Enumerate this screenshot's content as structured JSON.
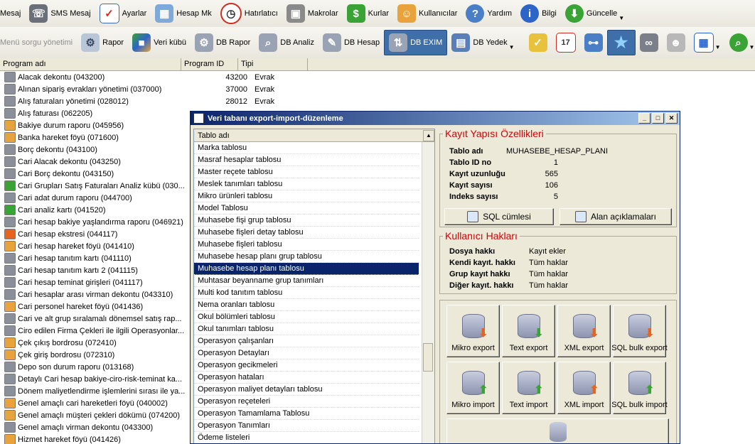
{
  "toolbar1": {
    "items": [
      {
        "label": "Mesaj",
        "icon": "message-icon"
      },
      {
        "label": "SMS Mesaj",
        "icon": "mobile-phone-icon"
      },
      {
        "label": "Ayarlar",
        "icon": "checklist-icon"
      },
      {
        "label": "Hesap Mk",
        "icon": "calculator-icon"
      },
      {
        "label": "Hatırlatıcı",
        "icon": "alarm-clock-icon"
      },
      {
        "label": "Makrolar",
        "icon": "tape-recorder-icon"
      },
      {
        "label": "Kurlar",
        "icon": "currency-icon"
      },
      {
        "label": "Kullanıcılar",
        "icon": "users-icon"
      },
      {
        "label": "Yardım",
        "icon": "help-icon"
      },
      {
        "label": "Bilgi",
        "icon": "info-icon"
      },
      {
        "label": "Güncelle",
        "icon": "update-globe-icon"
      }
    ]
  },
  "toolbar2": {
    "group_label": "Menü sorgu yönetimi",
    "items": [
      {
        "label": "Rapor",
        "icon": "report-gear-icon"
      },
      {
        "label": "Veri kübü",
        "icon": "data-cube-icon"
      },
      {
        "label": "DB Rapor",
        "icon": "db-report-icon"
      },
      {
        "label": "DB Analiz",
        "icon": "db-analysis-icon"
      },
      {
        "label": "DB Hesap",
        "icon": "db-calc-icon"
      },
      {
        "label": "DB EXIM",
        "icon": "db-exim-icon",
        "active": true
      },
      {
        "label": "DB Yedek",
        "icon": "db-backup-icon"
      }
    ],
    "extra_icons": [
      "clean-brush-icon",
      "calendar-icon",
      "org-chart-icon",
      "favorite-star-icon",
      "binoculars-icon",
      "user-gray-icon",
      "grid-view-icon",
      "search-globe-icon"
    ],
    "calendar_day": "17"
  },
  "list": {
    "headers": {
      "name": "Program adı",
      "id": "Program ID",
      "type": "Tipi"
    },
    "rows": [
      {
        "name": "Alacak dekontu (043200)",
        "id": "43200",
        "type": "Evrak"
      },
      {
        "name": "Alınan sipariş evrakları yönetimi (037000)",
        "id": "37000",
        "type": "Evrak"
      },
      {
        "name": "Alış faturaları yönetimi (028012)",
        "id": "28012",
        "type": "Evrak"
      },
      {
        "name": "Alış faturası (062205)",
        "id": "",
        "type": ""
      },
      {
        "name": "Bakiye durum raporu (045956)",
        "id": "",
        "type": ""
      },
      {
        "name": "Banka hareket föyü (071600)",
        "id": "",
        "type": ""
      },
      {
        "name": "Borç dekontu (043100)",
        "id": "",
        "type": ""
      },
      {
        "name": "Cari Alacak dekontu (043250)",
        "id": "",
        "type": ""
      },
      {
        "name": "Cari Borç dekontu (043150)",
        "id": "",
        "type": ""
      },
      {
        "name": "Cari Grupları Satış Faturaları Analiz kübü (030...",
        "id": "",
        "type": ""
      },
      {
        "name": "Cari adat durum raporu (044700)",
        "id": "",
        "type": ""
      },
      {
        "name": "Cari analiz kartı (041520)",
        "id": "",
        "type": ""
      },
      {
        "name": "Cari hesap bakiye yaşlandırma raporu (046921)",
        "id": "",
        "type": ""
      },
      {
        "name": "Cari hesap ekstresi (044117)",
        "id": "",
        "type": ""
      },
      {
        "name": "Cari hesap hareket föyü (041410)",
        "id": "",
        "type": ""
      },
      {
        "name": "Cari hesap tanıtım kartı (041110)",
        "id": "",
        "type": ""
      },
      {
        "name": "Cari hesap tanıtım kartı 2 (041115)",
        "id": "",
        "type": ""
      },
      {
        "name": "Cari hesap teminat girişleri (041117)",
        "id": "",
        "type": ""
      },
      {
        "name": "Cari hesaplar arası virman dekontu (043310)",
        "id": "",
        "type": ""
      },
      {
        "name": "Cari personel hareket föyü (041436)",
        "id": "",
        "type": ""
      },
      {
        "name": "Cari ve alt grup sıralamalı dönemsel satış rap...",
        "id": "",
        "type": ""
      },
      {
        "name": "Ciro edilen Firma Çekleri ile ilgili Operasyonlar...",
        "id": "",
        "type": ""
      },
      {
        "name": "Çek çıkış bordrosu (072410)",
        "id": "",
        "type": ""
      },
      {
        "name": "Çek giriş bordrosu (072310)",
        "id": "",
        "type": ""
      },
      {
        "name": "Depo son durum raporu (013168)",
        "id": "",
        "type": ""
      },
      {
        "name": "Detaylı Cari hesap bakiye-ciro-risk-teminat ka...",
        "id": "",
        "type": ""
      },
      {
        "name": "Dönem maliyetlendirme işlemlerini sırası ile ya...",
        "id": "",
        "type": ""
      },
      {
        "name": "Genel amaçlı cari hareketleri föyü (040002)",
        "id": "",
        "type": ""
      },
      {
        "name": "Genel amaçlı müşteri çekleri dökümü (074200)",
        "id": "",
        "type": ""
      },
      {
        "name": "Genel amaçlı virman dekontu (043300)",
        "id": "",
        "type": ""
      },
      {
        "name": "Hizmet hareket föyü (041426)",
        "id": "",
        "type": ""
      }
    ]
  },
  "dialog": {
    "title": "Veri tabanı export-import-düzenleme",
    "table_list": {
      "header": "Tablo adı",
      "items": [
        "Marka tablosu",
        "Masraf hesaplar tablosu",
        "Master reçete tablosu",
        "Meslek tanımları tablosu",
        "Mikro ürünleri tablosu",
        "Model Tablosu",
        "Muhasebe fişi grup tablosu",
        "Muhasebe fişleri detay tablosu",
        "Muhasebe fişleri tablosu",
        "Muhasebe hesap planı grup tablosu",
        "Muhasebe hesap planı tablosu",
        "Muhtasar beyanname grup tanımları",
        "Multi kod tanıtım tablosu",
        "Nema oranları tablosu",
        "Okul bölümleri tablosu",
        "Okul tanımları tablosu",
        "Operasyon çalışanları",
        "Operasyon Detayları",
        "Operasyon gecikmeleri",
        "Operasyon hataları",
        "Operasyon maliyet detayları tablosu",
        "Operasyon reçeteleri",
        "Operasyon Tamamlama Tablosu",
        "Operasyon Tanımları",
        "Ödeme listeleri"
      ],
      "selected": "Muhasebe hesap planı tablosu"
    },
    "structure": {
      "title": "Kayıt Yapısı Özellikleri",
      "fields": [
        {
          "label": "Tablo adı",
          "value": "MUHASEBE_HESAP_PLANI"
        },
        {
          "label": "Tablo ID no",
          "value": "1"
        },
        {
          "label": "Kayıt uzunluğu",
          "value": "565"
        },
        {
          "label": "Kayıt sayısı",
          "value": "106"
        },
        {
          "label": "Indeks sayısı",
          "value": "5"
        }
      ],
      "sql_button": "SQL cümlesi",
      "fields_button": "Alan açıklamaları"
    },
    "rights": {
      "title": "Kullanıcı Hakları",
      "fields": [
        {
          "label": "Dosya hakkı",
          "value": "Kayıt ekler"
        },
        {
          "label": "Kendi kayıt. hakkı",
          "value": "Tüm haklar"
        },
        {
          "label": "Grup kayıt hakkı",
          "value": "Tüm haklar"
        },
        {
          "label": "Diğer kayıt. hakkı",
          "value": "Tüm haklar"
        }
      ]
    },
    "actions": [
      {
        "label": "Mikro export",
        "icon": "db-export-icon",
        "color": "#e8641c"
      },
      {
        "label": "Text export",
        "icon": "text-export-icon",
        "color": "#3aa335"
      },
      {
        "label": "XML export",
        "icon": "xml-export-icon",
        "color": "#e8641c"
      },
      {
        "label": "SQL bulk export",
        "icon": "sql-export-icon",
        "color": "#e8641c"
      },
      {
        "label": "Mikro import",
        "icon": "db-import-icon",
        "color": "#3aa335"
      },
      {
        "label": "Text import",
        "icon": "text-import-icon",
        "color": "#3aa335"
      },
      {
        "label": "XML import",
        "icon": "xml-import-icon",
        "color": "#e8641c"
      },
      {
        "label": "SQL bulk import",
        "icon": "sql-import-icon",
        "color": "#3aa335"
      }
    ]
  }
}
